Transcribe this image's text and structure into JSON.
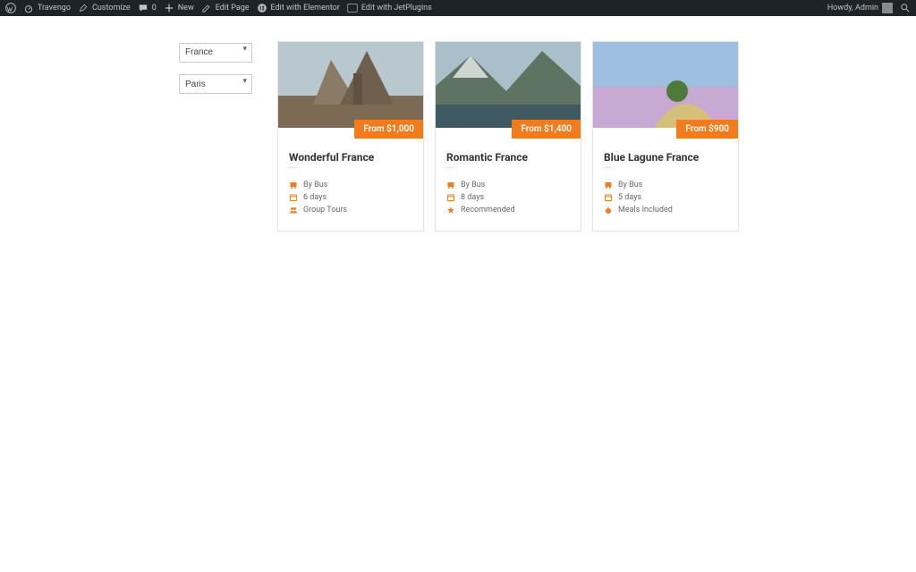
{
  "adminbar": {
    "site": "Travengo",
    "customize": "Customize",
    "comments": "0",
    "new": "New",
    "edit_page": "Edit Page",
    "edit_elementor": "Edit with Elementor",
    "edit_jet": "Edit with JetPlugins",
    "howdy": "Howdy, Admin"
  },
  "filters": {
    "country": "France",
    "city": "Paris"
  },
  "cards": [
    {
      "price": "From $1,000",
      "title": "Wonderful France",
      "meta": [
        {
          "icon": "bus-icon",
          "text": "By Bus"
        },
        {
          "icon": "calendar-icon",
          "text": "6 days"
        },
        {
          "icon": "group-icon",
          "text": "Group Tours"
        }
      ]
    },
    {
      "price": "From $1,400",
      "title": "Romantic France",
      "meta": [
        {
          "icon": "bus-icon",
          "text": "By Bus"
        },
        {
          "icon": "calendar-icon",
          "text": "8 days"
        },
        {
          "icon": "star-icon",
          "text": "Recommended"
        }
      ]
    },
    {
      "price": "From $900",
      "title": "Blue Lagune France",
      "meta": [
        {
          "icon": "bus-icon",
          "text": "By Bus"
        },
        {
          "icon": "calendar-icon",
          "text": "5 days"
        },
        {
          "icon": "meal-icon",
          "text": "Meals Included"
        }
      ]
    }
  ]
}
